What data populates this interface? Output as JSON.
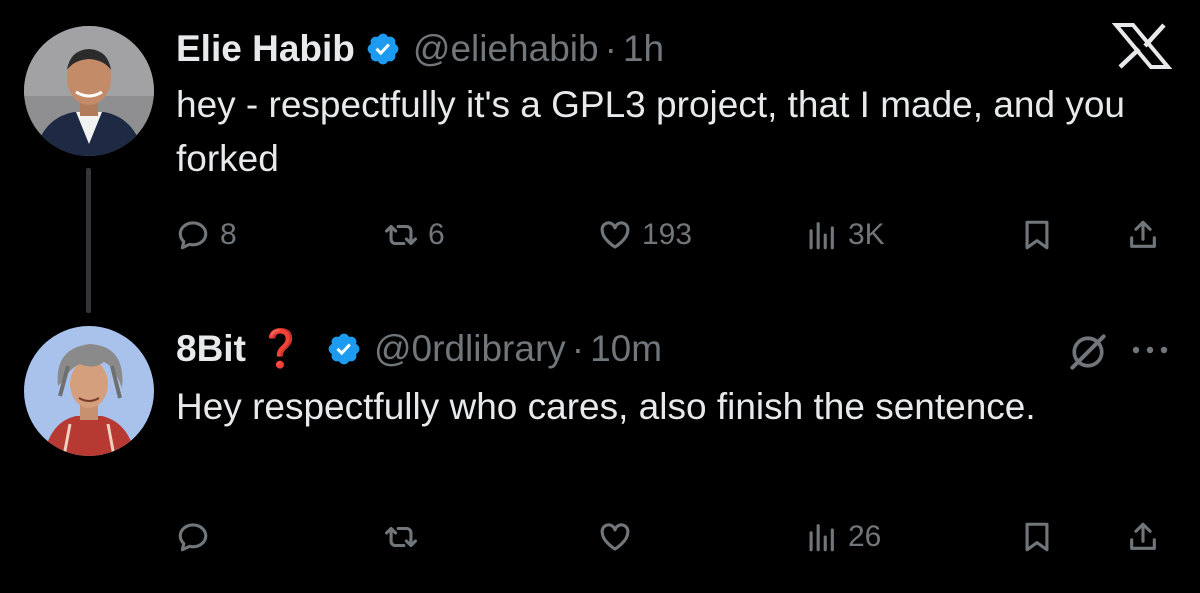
{
  "tweets": [
    {
      "author_name": "Elie Habib",
      "handle": "@eliehabib",
      "separator": "·",
      "time": "1h",
      "text": "hey - respectfully it's a GPL3 project, that I made, and you forked",
      "stats": {
        "replies": "8",
        "reposts": "6",
        "likes": "193",
        "views": "3K"
      }
    },
    {
      "author_name": "8Bit",
      "name_emoji": "❓",
      "handle": "@0rdlibrary",
      "separator": "·",
      "time": "10m",
      "text": "Hey respectfully who cares, also finish the sentence.",
      "stats": {
        "views": "26"
      }
    }
  ],
  "icons": {
    "top_right": "x-logo-icon",
    "verified": "verified-badge-icon",
    "reply": "reply-icon",
    "repost": "repost-icon",
    "like": "heart-icon",
    "views": "views-icon",
    "bookmark": "bookmark-icon",
    "share": "share-icon",
    "mute": "mute-icon",
    "more": "more-icon"
  },
  "colors": {
    "background": "#000000",
    "text": "#e7e9ea",
    "secondary": "#71767b",
    "verified": "#1d9bf0",
    "thread_line": "#333639",
    "question_mark": "#e0242f"
  }
}
